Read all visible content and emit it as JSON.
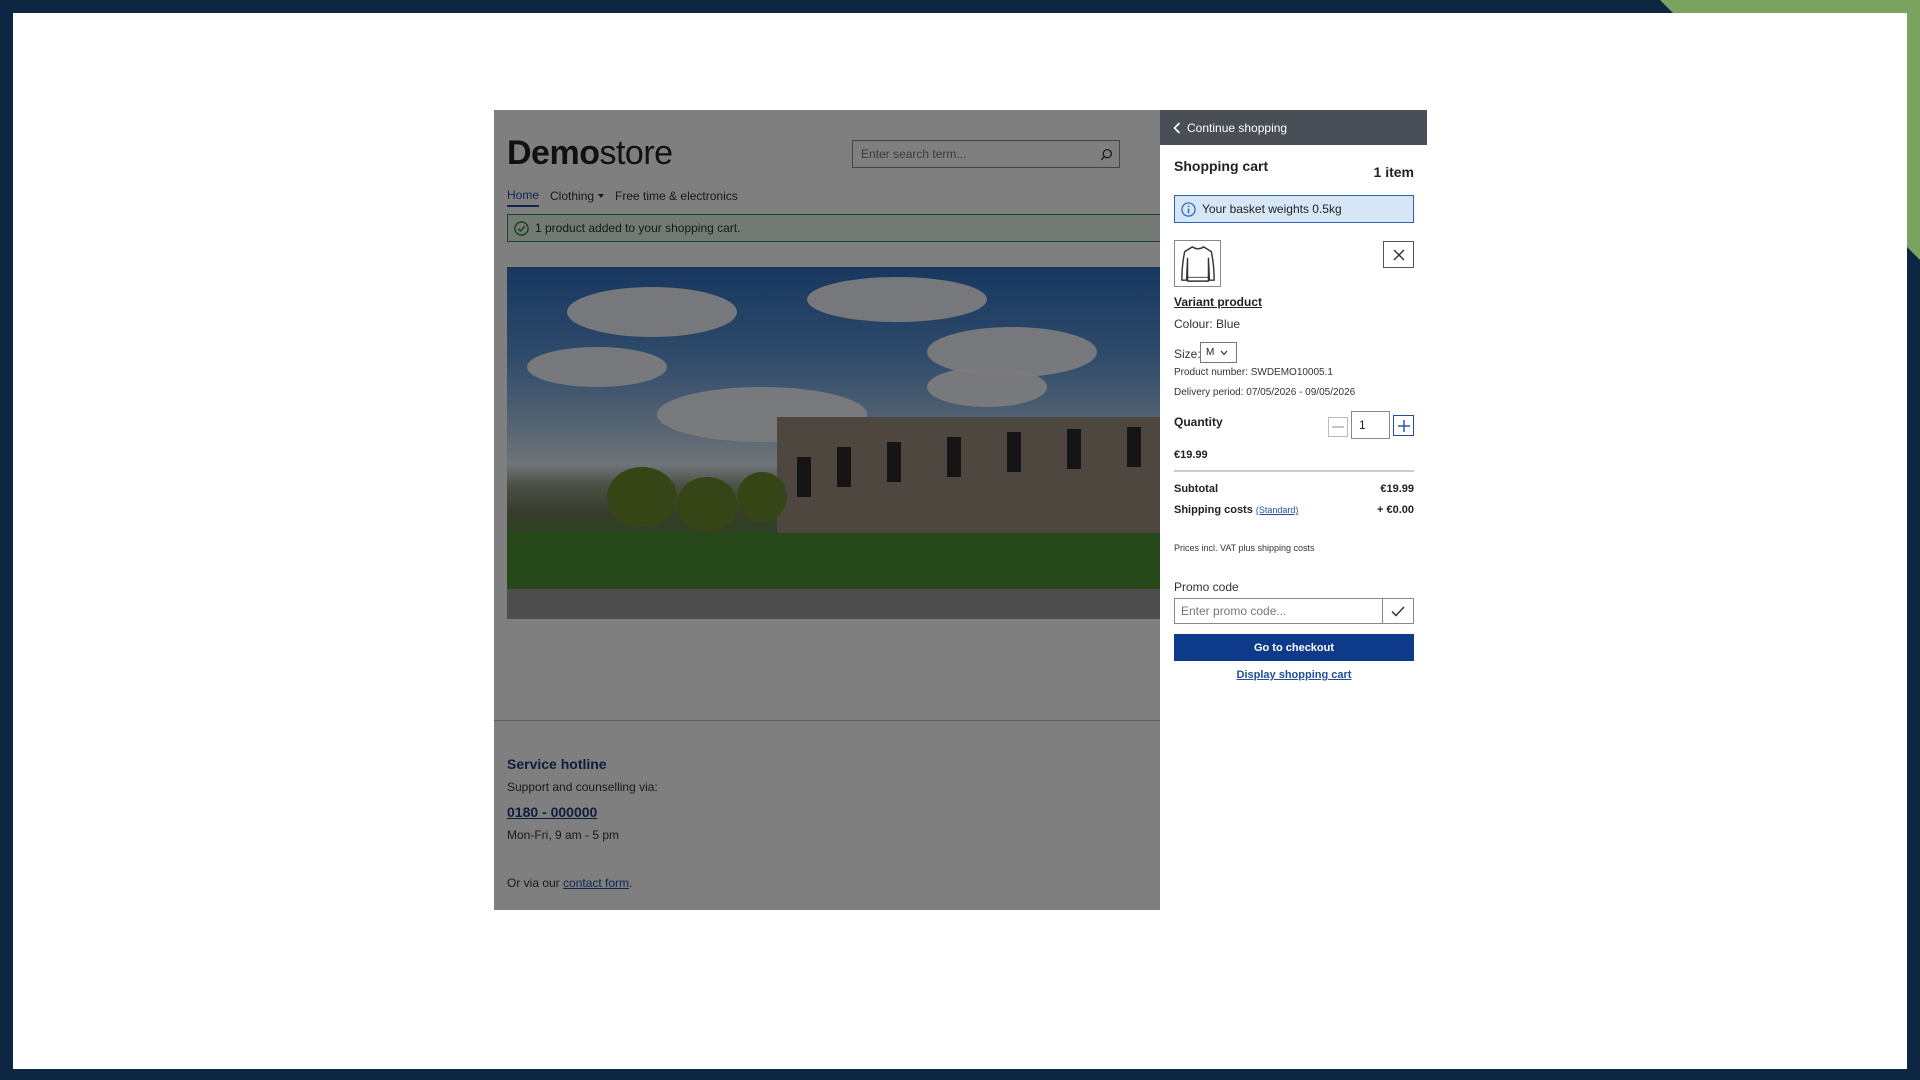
{
  "store": {
    "logo_bold": "Demo",
    "logo_light": "store",
    "search_placeholder": "Enter search term...",
    "nav": {
      "home": "Home",
      "clothing": "Clothing",
      "free_time": "Free time & electronics"
    },
    "alert": "1 product added to your shopping cart.",
    "footer": {
      "title": "Service hotline",
      "support": "Support and counselling via:",
      "phone": "0180 - 000000",
      "hours": "Mon-Fri, 9 am - 5 pm",
      "contact_prefix": "Or via our ",
      "contact_link": "contact form",
      "contact_suffix": "."
    }
  },
  "cart": {
    "continue": "Continue shopping",
    "title": "Shopping cart",
    "count": "1 item",
    "weight_info": "Your basket weights 0.5kg",
    "product_name": "Variant product",
    "colour": "Colour: Blue",
    "size_label": "Size:",
    "size_value": "M",
    "product_number": "Product number: SWDEMO10005.1",
    "delivery": "Delivery period: 07/05/2026 - 09/05/2026",
    "quantity_label": "Quantity",
    "quantity_value": "1",
    "price": "€19.99",
    "subtotal_label": "Subtotal",
    "subtotal_value": "€19.99",
    "shipping_label": "Shipping costs",
    "shipping_method": "(Standard)",
    "shipping_value": "+ €0.00",
    "vat_note": "Prices incl. VAT plus shipping costs",
    "promo_label": "Promo code",
    "promo_placeholder": "Enter promo code...",
    "checkout_button": "Go to checkout",
    "display_cart": "Display shopping cart"
  },
  "colors": {
    "frame": "#0d2742",
    "accent_green": "#7aa35f",
    "brand_blue": "#0e3a8c",
    "link_blue": "#1f4e9c"
  }
}
